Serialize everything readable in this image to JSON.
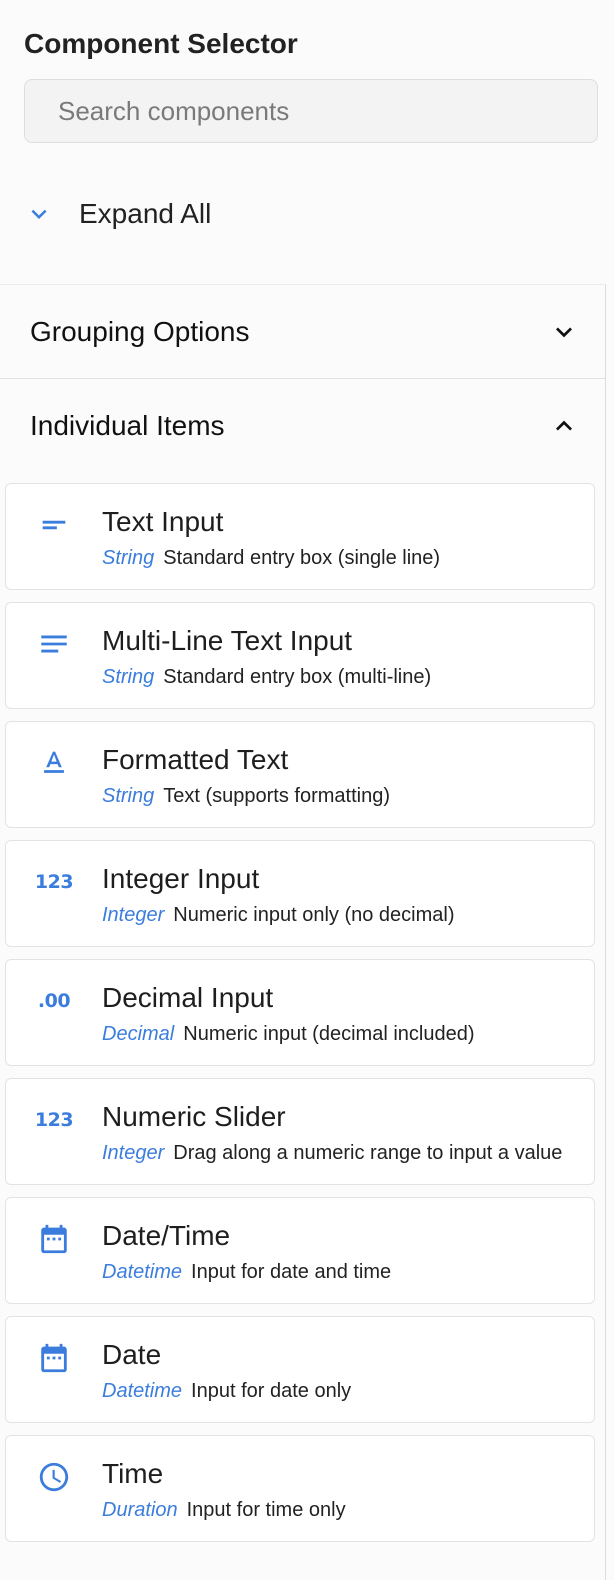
{
  "panel": {
    "title": "Component Selector"
  },
  "search": {
    "placeholder": "Search components",
    "value": ""
  },
  "expand_all": {
    "label": "Expand All",
    "icon": "chevron-down-icon"
  },
  "groups": [
    {
      "label": "Grouping Options",
      "expanded": false,
      "icon": "chevron-down-icon"
    },
    {
      "label": "Individual Items",
      "expanded": true,
      "icon": "chevron-up-icon"
    }
  ],
  "items": [
    {
      "name": "Text Input",
      "type": "String",
      "description": "Standard entry box (single line)",
      "icon": "short-text-icon"
    },
    {
      "name": "Multi-Line Text Input",
      "type": "String",
      "description": "Standard entry box (multi-line)",
      "icon": "notes-icon"
    },
    {
      "name": "Formatted Text",
      "type": "String",
      "description": "Text (supports formatting)",
      "icon": "text-format-icon"
    },
    {
      "name": "Integer Input",
      "type": "Integer",
      "description": "Numeric input only (no decimal)",
      "icon": "numbers-icon",
      "glyph": "123"
    },
    {
      "name": "Decimal Input",
      "type": "Decimal",
      "description": "Numeric input (decimal included)",
      "icon": "decimal-icon",
      "glyph": ".00"
    },
    {
      "name": "Numeric Slider",
      "type": "Integer",
      "description": "Drag along a numeric range to input a value",
      "icon": "numbers-icon",
      "glyph": "123"
    },
    {
      "name": "Date/Time",
      "type": "Datetime",
      "description": "Input for date and time",
      "icon": "calendar-icon"
    },
    {
      "name": "Date",
      "type": "Datetime",
      "description": "Input for date only",
      "icon": "calendar-icon"
    },
    {
      "name": "Time",
      "type": "Duration",
      "description": "Input for time only",
      "icon": "clock-icon"
    }
  ],
  "colors": {
    "accent": "#3b7ddd",
    "card_border": "#e3e3e3",
    "background": "#fbfbfb"
  }
}
